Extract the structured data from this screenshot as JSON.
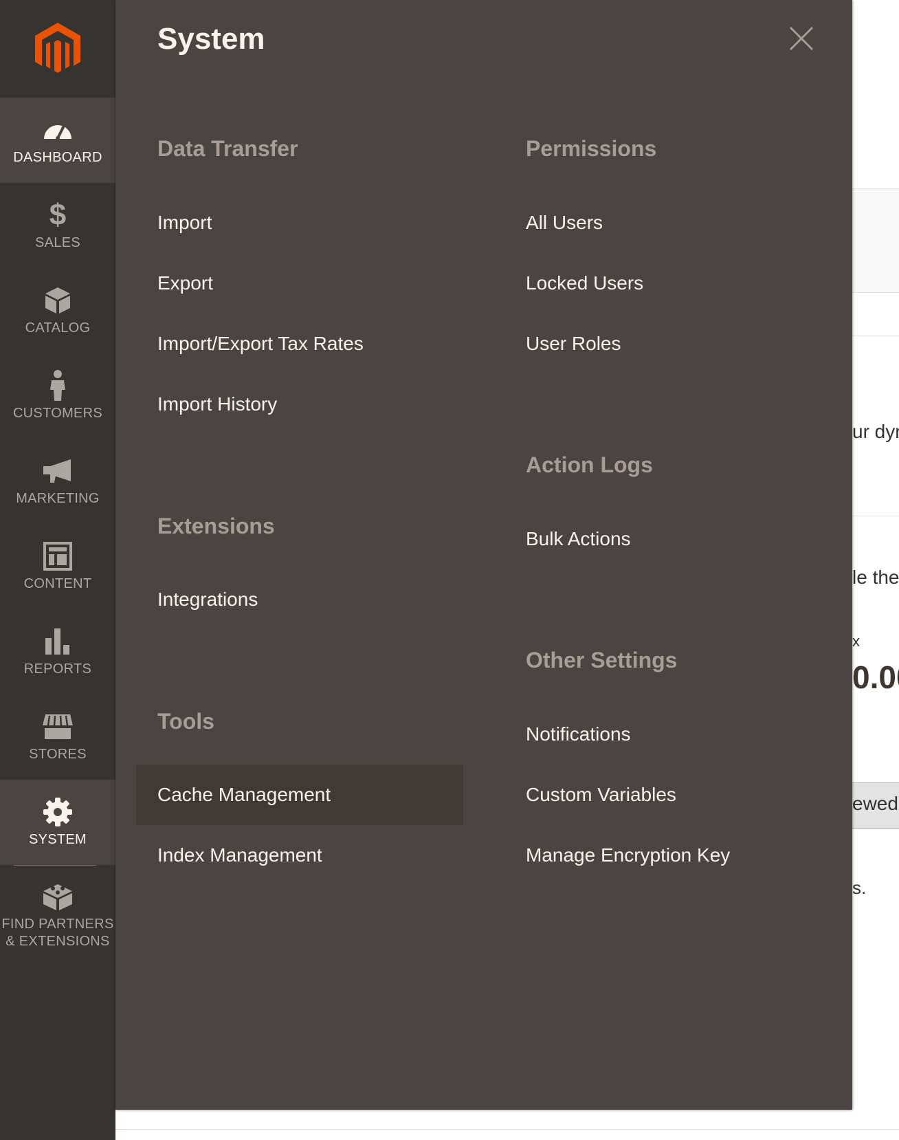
{
  "flyout": {
    "title": "System",
    "close_icon": "close-icon",
    "columns": [
      {
        "sections": [
          {
            "title": "Data Transfer",
            "items": [
              "Import",
              "Export",
              "Import/Export Tax Rates",
              "Import History"
            ]
          },
          {
            "title": "Extensions",
            "items": [
              "Integrations"
            ]
          },
          {
            "title": "Tools",
            "items": [
              "Cache Management",
              "Index Management"
            ],
            "active_item": "Cache Management"
          }
        ]
      },
      {
        "sections": [
          {
            "title": "Permissions",
            "items": [
              "All Users",
              "Locked Users",
              "User Roles"
            ]
          },
          {
            "title": "Action Logs",
            "items": [
              "Bulk Actions"
            ]
          },
          {
            "title": "Other Settings",
            "items": [
              "Notifications",
              "Custom Variables",
              "Manage Encryption Key"
            ]
          }
        ]
      }
    ]
  },
  "sidebar": {
    "logo_icon": "magento-logo-icon",
    "items": [
      {
        "label": "DASHBOARD",
        "icon": "speedometer-icon"
      },
      {
        "label": "SALES",
        "icon": "dollar-icon"
      },
      {
        "label": "CATALOG",
        "icon": "box-icon"
      },
      {
        "label": "CUSTOMERS",
        "icon": "person-icon"
      },
      {
        "label": "MARKETING",
        "icon": "megaphone-icon"
      },
      {
        "label": "CONTENT",
        "icon": "layout-icon"
      },
      {
        "label": "REPORTS",
        "icon": "bar-chart-icon"
      },
      {
        "label": "STORES",
        "icon": "storefront-icon"
      },
      {
        "label": "SYSTEM",
        "icon": "gear-icon"
      },
      {
        "label_line1": "FIND PARTNERS",
        "label_line2": "& EXTENSIONS",
        "icon": "blocks-icon"
      }
    ]
  },
  "background": {
    "text_fragment_1": "ur dyr",
    "text_fragment_2": "le the",
    "text_fragment_3": "x",
    "big_value_fragment": "0.00",
    "button_fragment": "ewed",
    "text_fragment_4": "s."
  },
  "colors": {
    "sidebar_bg": "#373330",
    "sidebar_active_bg": "#4a4542",
    "flyout_bg": "#4a4542",
    "active_item_bg": "#403934",
    "section_title": "#a79d95",
    "menu_text": "#f7f3eb",
    "logo_orange": "#eb5202"
  }
}
